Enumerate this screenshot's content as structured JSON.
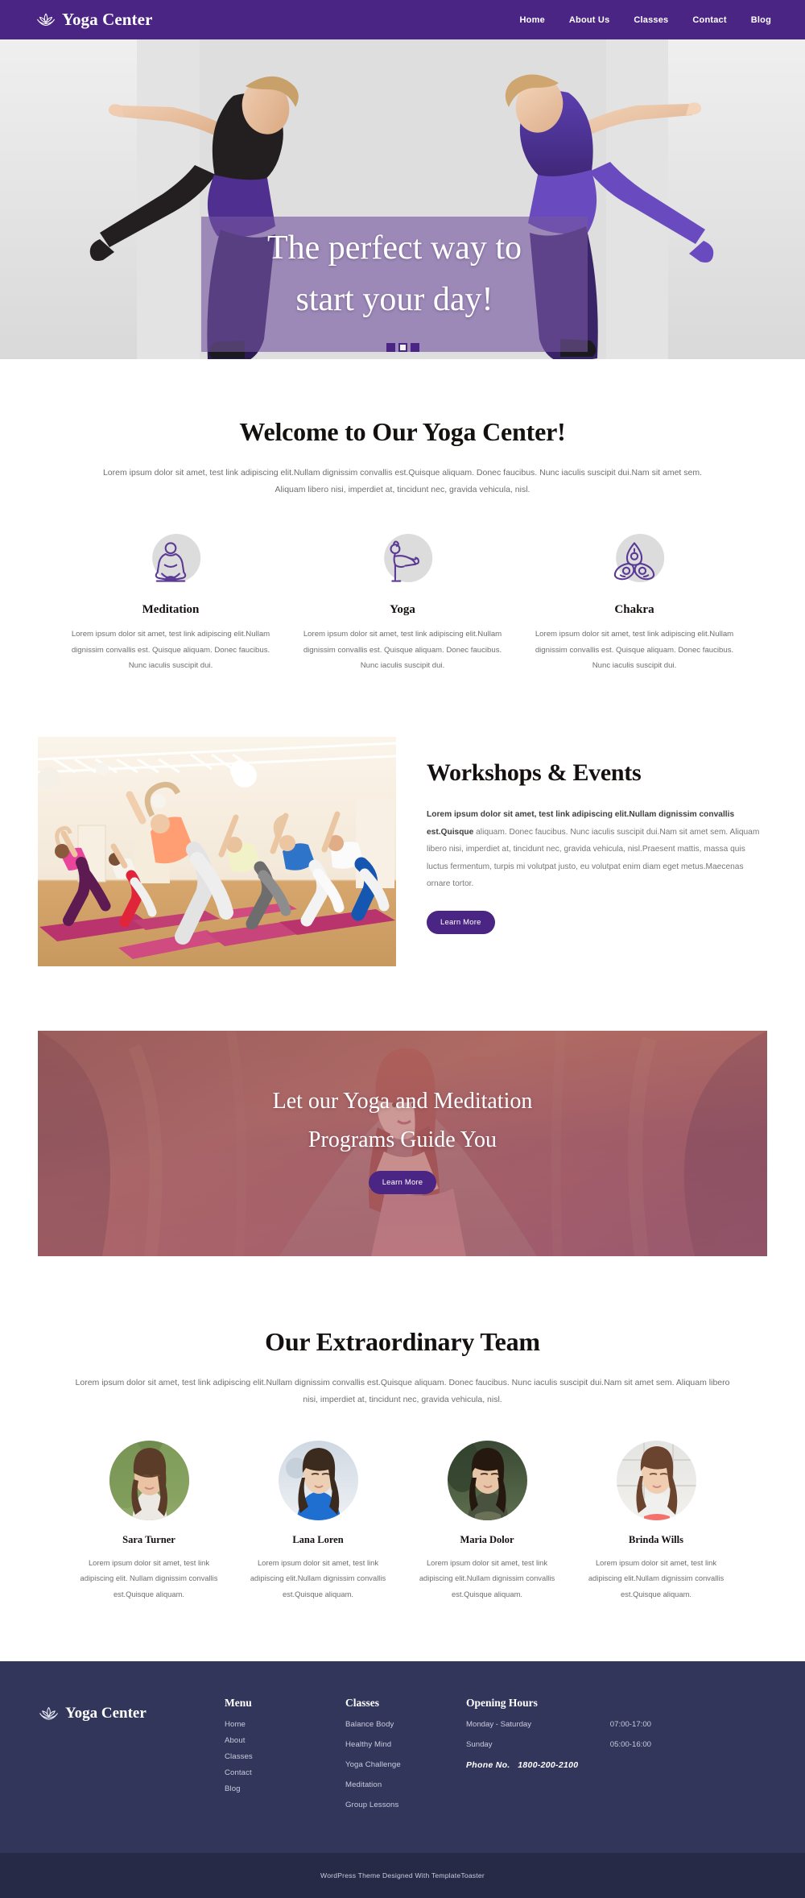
{
  "header": {
    "brand": "Yoga Center",
    "logo_icon": "lotus-icon",
    "nav": [
      {
        "label": "Home"
      },
      {
        "label": "About Us"
      },
      {
        "label": "Classes"
      },
      {
        "label": "Contact"
      },
      {
        "label": "Blog"
      }
    ]
  },
  "hero": {
    "headline_line1": "The perfect way to",
    "headline_line2": "start your day!",
    "slides": [
      {
        "active": false
      },
      {
        "active": true
      },
      {
        "active": false
      }
    ]
  },
  "welcome": {
    "title": "Welcome to Our Yoga Center!",
    "lead": "Lorem ipsum dolor sit amet, test link adipiscing elit.Nullam dignissim convallis est.Quisque aliquam. Donec faucibus. Nunc iaculis suscipit dui.Nam sit amet sem. Aliquam libero nisi, imperdiet at, tincidunt nec, gravida vehicula, nisl."
  },
  "services": [
    {
      "icon": "meditation-lotus-pose-icon",
      "name": "Meditation",
      "desc": "Lorem ipsum dolor sit amet, test link adipiscing elit.Nullam dignissim convallis est. Quisque aliquam. Donec faucibus. Nunc iaculis suscipit dui."
    },
    {
      "icon": "yoga-standing-pose-icon",
      "name": "Yoga",
      "desc": "Lorem ipsum dolor sit amet, test link adipiscing elit.Nullam dignissim convallis est. Quisque aliquam. Donec faucibus. Nunc iaculis suscipit dui."
    },
    {
      "icon": "chakra-trinity-icon",
      "name": "Chakra",
      "desc": "Lorem ipsum dolor sit amet, test link adipiscing elit.Nullam dignissim convallis est. Quisque aliquam. Donec faucibus. Nunc iaculis suscipit dui."
    }
  ],
  "workshops": {
    "title": "Workshops & Events",
    "body_bold": "Lorem ipsum dolor sit amet, test link adipiscing elit.Nullam dignissim convallis est.Quisque",
    "body_rest": " aliquam. Donec faucibus. Nunc iaculis suscipit dui.Nam sit amet sem. Aliquam libero nisi, imperdiet at, tincidunt nec, gravida vehicula, nisl.Praesent mattis, massa quis luctus fermentum, turpis mi volutpat justo, eu volutpat enim diam eget metus.Maecenas ornare tortor.",
    "button": "Learn More",
    "image_alt": "yoga-class-triangle-pose-photo"
  },
  "cta": {
    "headline_line1": "Let our Yoga and Meditation",
    "headline_line2": "Programs Guide You",
    "button": "Learn More",
    "image_alt": "woman-meditating-outdoors-photo"
  },
  "team": {
    "title": "Our Extraordinary Team",
    "lead": "Lorem ipsum dolor sit amet, test link adipiscing elit.Nullam dignissim convallis est.Quisque aliquam. Donec faucibus. Nunc iaculis suscipit dui.Nam sit amet sem. Aliquam libero nisi, imperdiet at, tincidunt nec, gravida vehicula, nisl.",
    "members": [
      {
        "name": "Sara Turner",
        "desc": "Lorem ipsum dolor sit amet, test link adipiscing elit. Nullam dignissim convallis est.Quisque aliquam."
      },
      {
        "name": "Lana Loren",
        "desc": "Lorem ipsum dolor sit amet, test link adipiscing elit.Nullam dignissim convallis est.Quisque aliquam."
      },
      {
        "name": "Maria Dolor",
        "desc": "Lorem ipsum dolor sit amet, test link adipiscing elit.Nullam dignissim convallis est.Quisque aliquam."
      },
      {
        "name": "Brinda Wills",
        "desc": "Lorem ipsum dolor sit amet, test link adipiscing elit.Nullam dignissim convallis est.Quisque aliquam."
      }
    ]
  },
  "footer": {
    "brand": "Yoga Center",
    "menu": {
      "heading": "Menu",
      "items": [
        {
          "label": "Home"
        },
        {
          "label": "About"
        },
        {
          "label": "Classes"
        },
        {
          "label": "Contact"
        },
        {
          "label": "Blog"
        }
      ]
    },
    "classes": {
      "heading": "Classes",
      "items": [
        {
          "label": "Balance Body"
        },
        {
          "label": "Healthy Mind"
        },
        {
          "label": "Yoga Challenge"
        },
        {
          "label": "Meditation"
        },
        {
          "label": "Group Lessons"
        }
      ]
    },
    "hours": {
      "heading": "Opening Hours",
      "rows": [
        {
          "days": "Monday - Saturday",
          "time": "07:00-17:00"
        },
        {
          "days": "Sunday",
          "time": "05:00-16:00"
        }
      ],
      "phone_label": "Phone No.",
      "phone_number": "1800-200-2100"
    },
    "copyright": "WordPress Theme Designed With TemplateToaster"
  },
  "colors": {
    "brand_purple": "#4b2583",
    "icon_purple": "#5b3a96",
    "footer_navy": "#33365b",
    "footer_bottom_navy": "#262a47"
  }
}
